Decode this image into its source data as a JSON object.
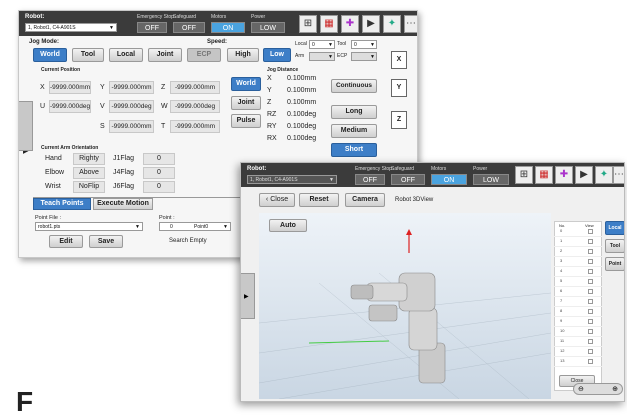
{
  "back": {
    "robot_label": "Robot:",
    "robot_select": "1, Robot1, C4-A901S",
    "emergency_label": "Emergency Stop",
    "emergency_value": "OFF",
    "safeguard_label": "Safeguard",
    "safeguard_value": "OFF",
    "motors_label": "Motors",
    "motors_value": "ON",
    "power_label": "Power",
    "power_value": "LOW",
    "jog_mode_label": "Jog Mode:",
    "modes": [
      "World",
      "Tool",
      "Local",
      "Joint",
      "ECP"
    ],
    "speed_label": "Speed:",
    "speeds": [
      "High",
      "Low"
    ],
    "local_label": "Local",
    "local_value": "0",
    "tool_label": "Tool",
    "tool_value": "0",
    "arm_label": "Arm",
    "ecp_label": "ECP",
    "current_position_label": "Current Position",
    "position": {
      "x_label": "X",
      "x_value": "-9999.000mm",
      "y_label": "Y",
      "y_value": "-9999.000mm",
      "z_label": "Z",
      "z_value": "-9999.000mm",
      "u_label": "U",
      "u_value": "-9999.000deg",
      "v_label": "V",
      "v_value": "-9999.000deg",
      "w_label": "W",
      "w_value": "-9999.000deg",
      "s_label": "S",
      "s_value": "-9999.000mm",
      "t_label": "T",
      "t_value": "-9999.000mm"
    },
    "pos_buttons": [
      "World",
      "Joint",
      "Pulse"
    ],
    "jog_distance_label": "Jog Distance",
    "jog_distance": [
      {
        "axis": "X",
        "value": "0.100mm"
      },
      {
        "axis": "Y",
        "value": "0.100mm"
      },
      {
        "axis": "Z",
        "value": "0.100mm"
      },
      {
        "axis": "RZ",
        "value": "0.100deg"
      },
      {
        "axis": "RY",
        "value": "0.100deg"
      },
      {
        "axis": "RX",
        "value": "0.100deg"
      }
    ],
    "distance_buttons": [
      "Continuous",
      "Long",
      "Medium",
      "Short"
    ],
    "side_buttons": [
      "X",
      "Y",
      "Z"
    ],
    "arm_orientation_label": "Current Arm Orientation",
    "orientation": [
      {
        "name": "Hand",
        "value": "Righty",
        "flag_label": "J1Flag",
        "flag_value": "0"
      },
      {
        "name": "Elbow",
        "value": "Above",
        "flag_label": "J4Flag",
        "flag_value": "0"
      },
      {
        "name": "Wrist",
        "value": "NoFlip",
        "flag_label": "J6Flag",
        "flag_value": "0"
      }
    ],
    "tabs": [
      "Teach Points",
      "Execute Motion"
    ],
    "point_file_label": "Point File :",
    "point_file_value": "robot1.pts",
    "point_label": "Point :",
    "point_number": "0",
    "point_name": "Point0",
    "edit_button": "Edit",
    "save_button": "Save",
    "search_empty_label": "Search Empty"
  },
  "front": {
    "robot_label": "Robot:",
    "robot_select": "1, Robot1, C4-A901S",
    "emergency_label": "Emergency Stop",
    "emergency_value": "OFF",
    "safeguard_label": "Safeguard",
    "safeguard_value": "OFF",
    "motors_label": "Motors",
    "motors_value": "ON",
    "power_label": "Power",
    "power_value": "LOW",
    "close_button": "Close",
    "reset_button": "Reset",
    "camera_button": "Camera",
    "view_title": "Robot 3DView",
    "auto_button": "Auto",
    "table_header_no": "No.",
    "table_header_view": "View",
    "table_rows": [
      "0",
      "1",
      "2",
      "3",
      "4",
      "5",
      "6",
      "7",
      "8",
      "9",
      "10",
      "11",
      "12",
      "13"
    ],
    "frame_buttons": [
      "Local",
      "Tool",
      "Point"
    ],
    "table_close_button": "Close"
  },
  "footer_text": "F"
}
